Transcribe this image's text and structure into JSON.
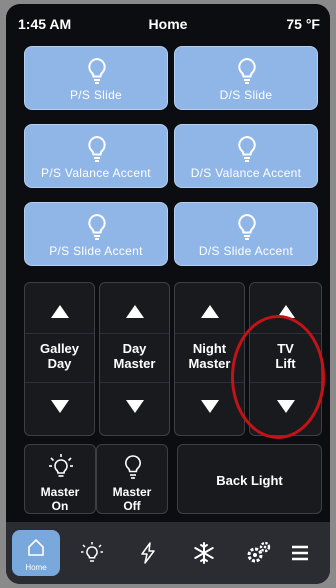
{
  "status_bar": {
    "time": "1:45 AM",
    "title": "Home",
    "temperature": "75 °F"
  },
  "lights": [
    {
      "label": "P/S Slide"
    },
    {
      "label": "D/S Slide"
    },
    {
      "label": "P/S Valance Accent"
    },
    {
      "label": "D/S Valance Accent"
    },
    {
      "label": "P/S Slide Accent"
    },
    {
      "label": "D/S Slide Accent"
    }
  ],
  "lifts": [
    {
      "line1": "Galley",
      "line2": "Day"
    },
    {
      "line1": "Day",
      "line2": "Master"
    },
    {
      "line1": "Night",
      "line2": "Master"
    },
    {
      "line1": "TV",
      "line2": "Lift"
    }
  ],
  "master": {
    "on": {
      "line1": "Master",
      "line2": "On"
    },
    "off": {
      "line1": "Master",
      "line2": "Off"
    }
  },
  "back_light": {
    "label": "Back Light"
  },
  "nav": {
    "home_label": "Home",
    "items": [
      "home-icon",
      "light-icon",
      "power-icon",
      "snowflake-icon",
      "gear-icon",
      "menu-icon"
    ]
  },
  "colors": {
    "light_tile": "#8fb6e6",
    "highlight_circle": "#c21318",
    "nav_active": "#78a8dc"
  }
}
